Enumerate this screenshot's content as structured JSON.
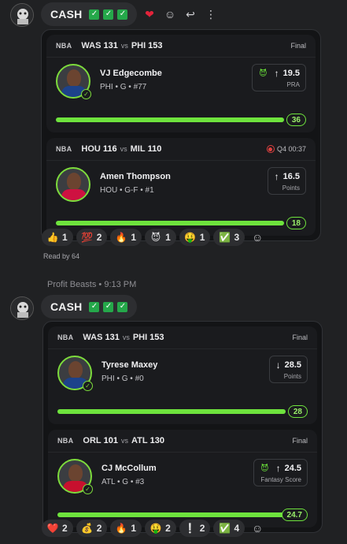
{
  "messages": [
    {
      "sender": "",
      "time": "",
      "text": "CASH",
      "checks": 3,
      "picks": [
        {
          "league": "NBA",
          "away_team": "WAS",
          "away_score": "131",
          "vs": "vs",
          "home_team": "PHI",
          "home_score": "153",
          "status": "Final",
          "player": "VJ Edgecombe",
          "meta": "PHI • G • #77",
          "line": "19.5",
          "stat": "PRA",
          "result": "36",
          "progress": 1.0,
          "jersey": "#1d428a"
        },
        {
          "league": "NBA",
          "away_team": "HOU",
          "away_score": "116",
          "vs": "vs",
          "home_team": "MIL",
          "home_score": "110",
          "status": "Q4 00:37",
          "player": "Amen Thompson",
          "meta": "HOU • G-F • #1",
          "line": "16.5",
          "stat": "Points",
          "result": "18",
          "progress": 1.0,
          "jersey": "#ce1141"
        }
      ],
      "reactions": [
        {
          "emoji": "👍",
          "count": "1"
        },
        {
          "emoji": "💯",
          "count": "2"
        },
        {
          "emoji": "🔥",
          "count": "1"
        },
        {
          "emoji": "😈",
          "count": "1"
        },
        {
          "emoji": "🤑",
          "count": "1"
        },
        {
          "emoji": "✅",
          "count": "3"
        }
      ],
      "read_by": "Read by 64"
    },
    {
      "sender": "Profit Beasts",
      "time": "9:13 PM",
      "text": "CASH",
      "checks": 3,
      "picks": [
        {
          "league": "NBA",
          "away_team": "WAS",
          "away_score": "131",
          "vs": "vs",
          "home_team": "PHI",
          "home_score": "153",
          "status": "Final",
          "player": "Tyrese Maxey",
          "meta": "PHI • G • #0",
          "line": "28.5",
          "stat": "Points",
          "result": "28",
          "progress": 1.0,
          "jersey": "#1d428a"
        },
        {
          "league": "NBA",
          "away_team": "ORL",
          "away_score": "101",
          "vs": "vs",
          "home_team": "ATL",
          "home_score": "130",
          "status": "Final",
          "player": "CJ McCollum",
          "meta": "ATL • G • #3",
          "line": "24.5",
          "stat": "Fantasy Score",
          "result": "24.7",
          "progress": 1.0,
          "jersey": "#c8102e"
        }
      ],
      "reactions": [
        {
          "emoji": "❤️",
          "count": "2"
        },
        {
          "emoji": "💰",
          "count": "2"
        },
        {
          "emoji": "🔥",
          "count": "1"
        },
        {
          "emoji": "🤑",
          "count": "2"
        },
        {
          "emoji": "❕",
          "count": "2"
        },
        {
          "emoji": "✅",
          "count": "4"
        }
      ],
      "read_by": ""
    }
  ],
  "meta_line": "Profit Beasts • 9:13 PM"
}
